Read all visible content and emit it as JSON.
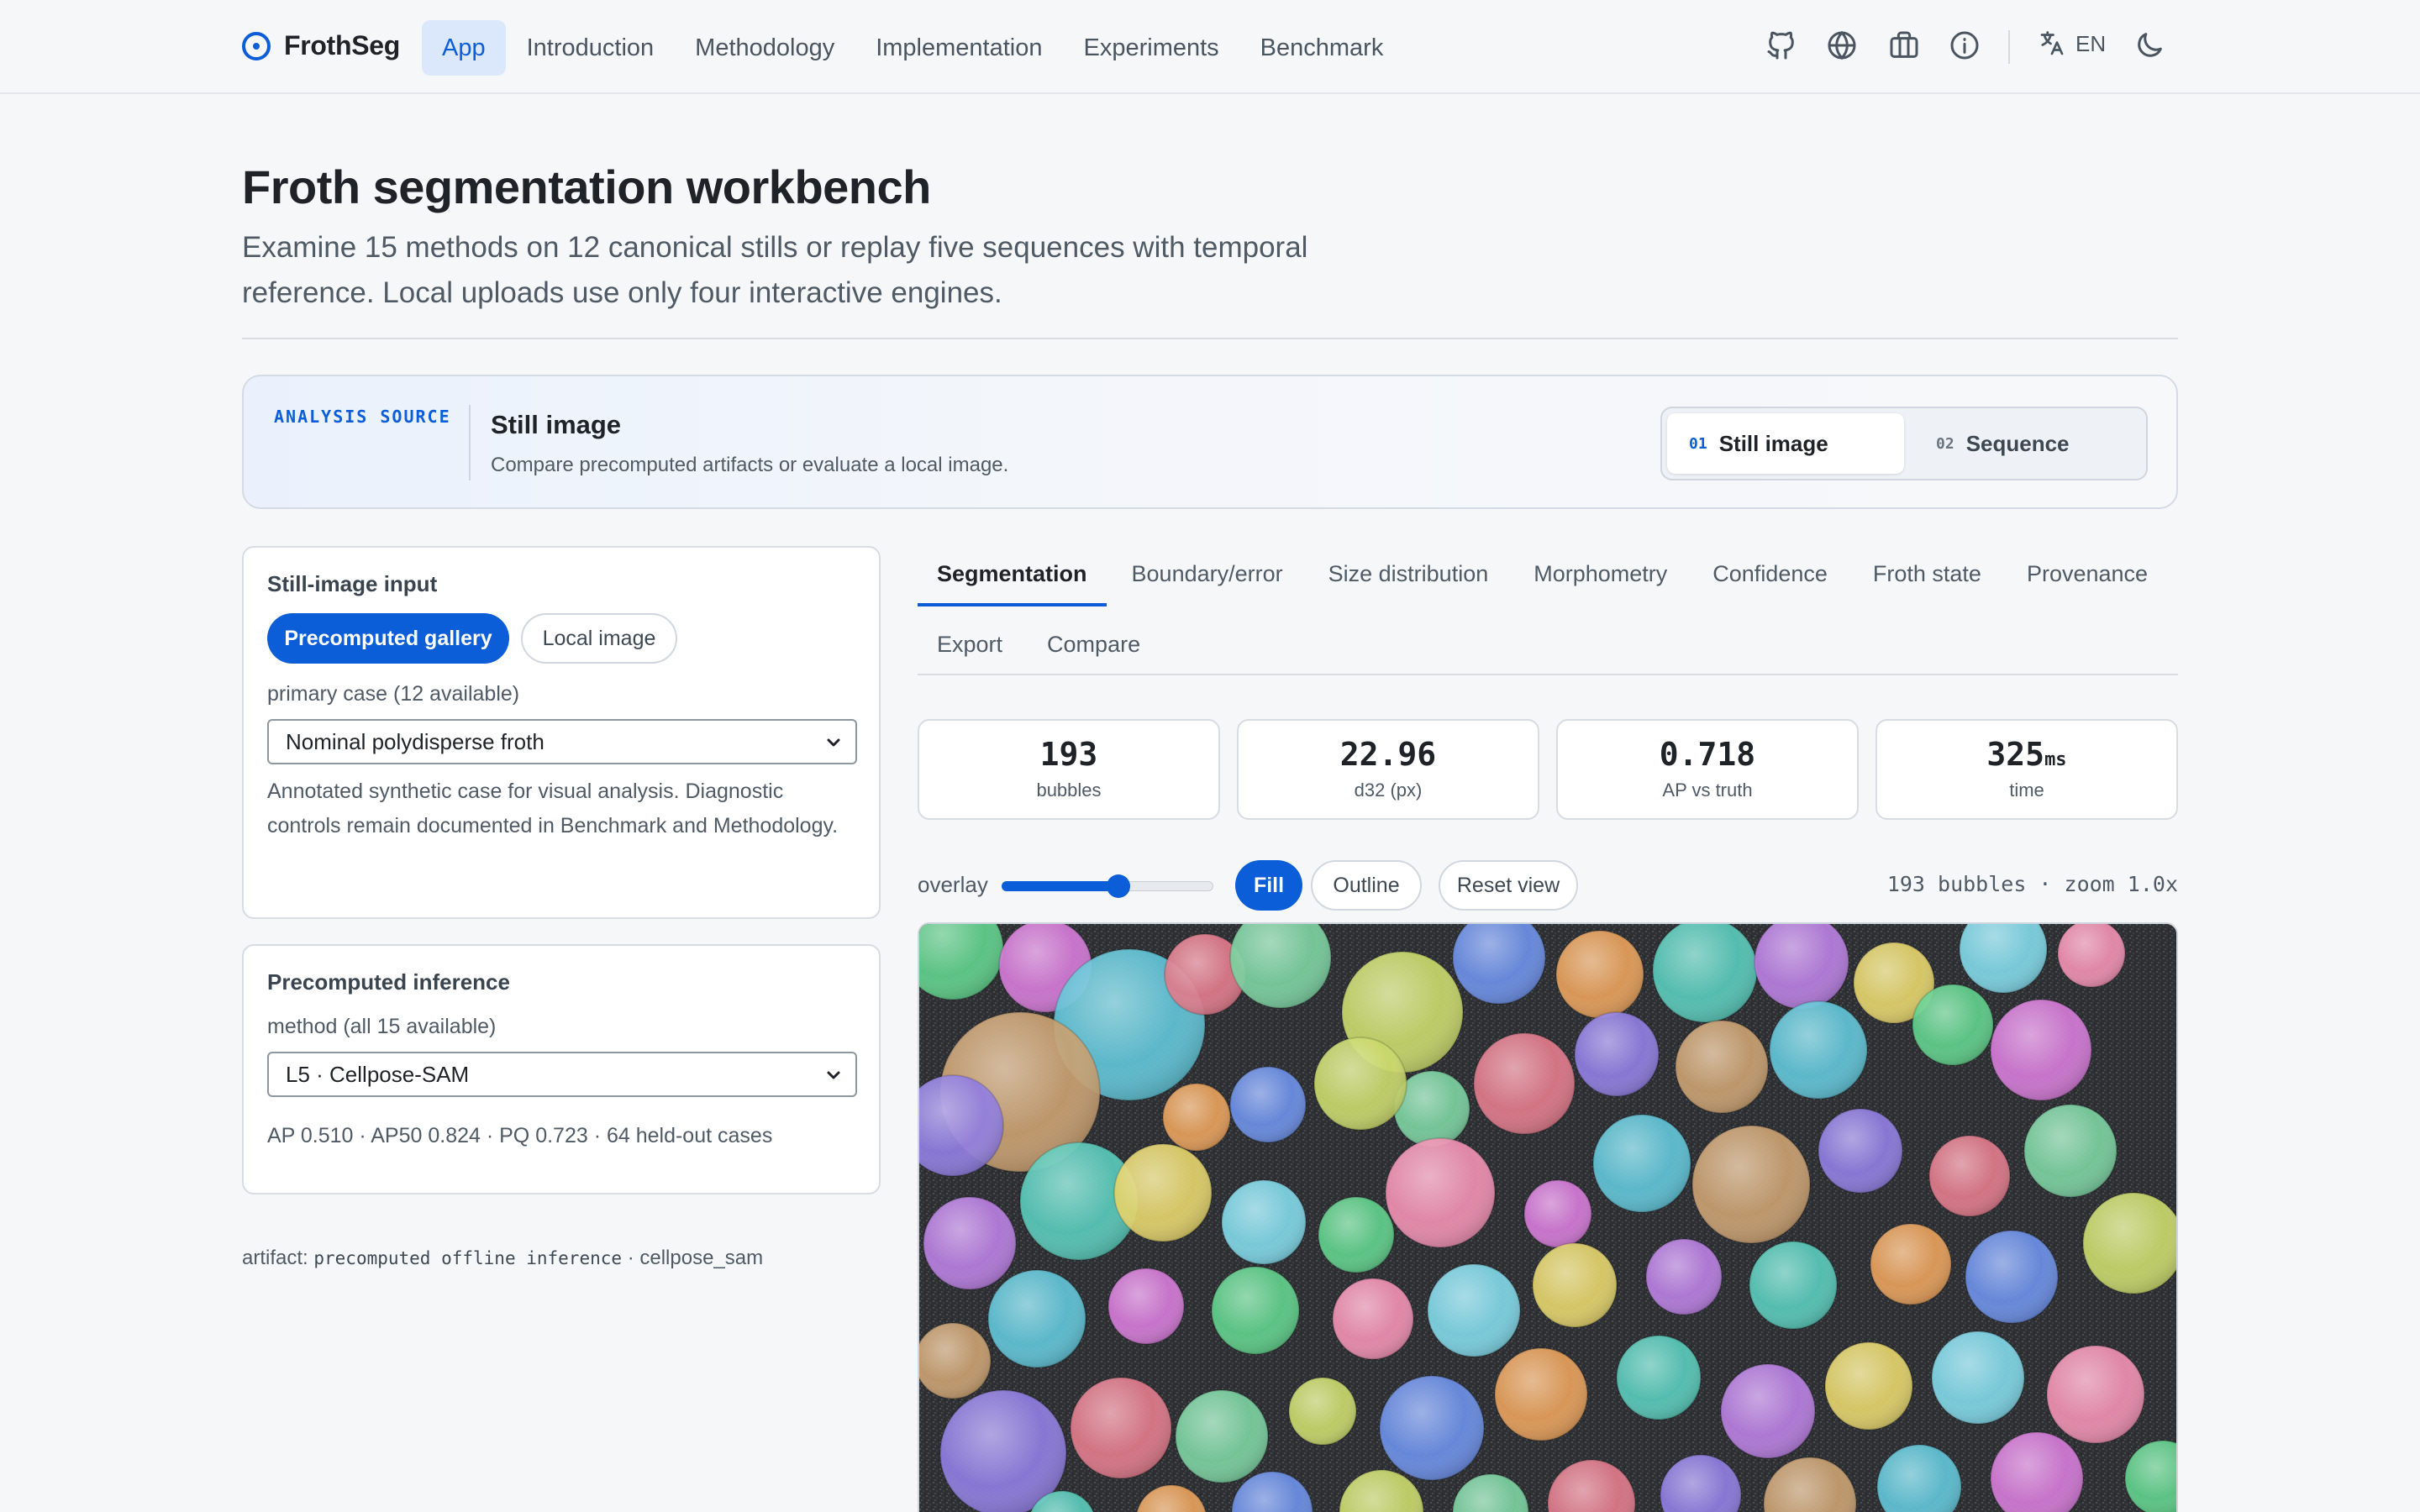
{
  "brand": {
    "name": "FrothSeg",
    "icon": "target-icon"
  },
  "nav": {
    "links": [
      "App",
      "Introduction",
      "Methodology",
      "Implementation",
      "Experiments",
      "Benchmark"
    ],
    "active": "App",
    "icons": [
      "github-icon",
      "globe-icon",
      "briefcase-icon",
      "info-icon"
    ],
    "language": "EN",
    "theme_icon": "moon-icon"
  },
  "page": {
    "title": "Froth segmentation workbench",
    "subtitle": "Examine 15 methods on 12 canonical stills or replay five sequences with temporal reference. Local uploads use only four interactive engines."
  },
  "source": {
    "kicker": "ANALYSIS SOURCE",
    "title": "Still image",
    "description": "Compare precomputed artifacts or evaluate a local image.",
    "options": [
      {
        "num": "01",
        "label": "Still image",
        "selected": true
      },
      {
        "num": "02",
        "label": "Sequence",
        "selected": false
      }
    ]
  },
  "still_input": {
    "title": "Still-image input",
    "modes": [
      "Precomputed gallery",
      "Local image"
    ],
    "active_mode": "Precomputed gallery",
    "case_label": "primary case (12 available)",
    "case_value": "Nominal polydisperse froth",
    "help": "Annotated synthetic case for visual analysis. Diagnostic controls remain documented in Benchmark and Methodology."
  },
  "inference": {
    "title": "Precomputed inference",
    "method_label": "method (all 15 available)",
    "method_value": "L5 · Cellpose-SAM",
    "scores": "AP 0.510 · AP50 0.824 · PQ 0.723 · 64 held-out cases"
  },
  "artifact": {
    "prefix": "artifact:",
    "code": "precomputed offline inference",
    "suffix": "· cellpose_sam"
  },
  "tabs": {
    "row1": [
      "Segmentation",
      "Boundary/error",
      "Size distribution",
      "Morphometry",
      "Confidence",
      "Froth state",
      "Provenance"
    ],
    "row2": [
      "Export",
      "Compare"
    ],
    "active": "Segmentation"
  },
  "metrics": [
    {
      "value": "193",
      "unit": "",
      "label": "bubbles"
    },
    {
      "value": "22.96",
      "unit": "",
      "label": "d32 (px)"
    },
    {
      "value": "0.718",
      "unit": "",
      "label": "AP vs truth"
    },
    {
      "value": "325",
      "unit": "ms",
      "label": "time"
    }
  ],
  "overlay": {
    "label": "overlay",
    "level": 0.55,
    "modes": [
      "Fill",
      "Outline"
    ],
    "active_mode": "Fill",
    "reset_label": "Reset view",
    "status": "193 bubbles · zoom 1.0x"
  },
  "colors": {
    "accent": "#0b5ed7",
    "background": "#f6f7f9"
  }
}
